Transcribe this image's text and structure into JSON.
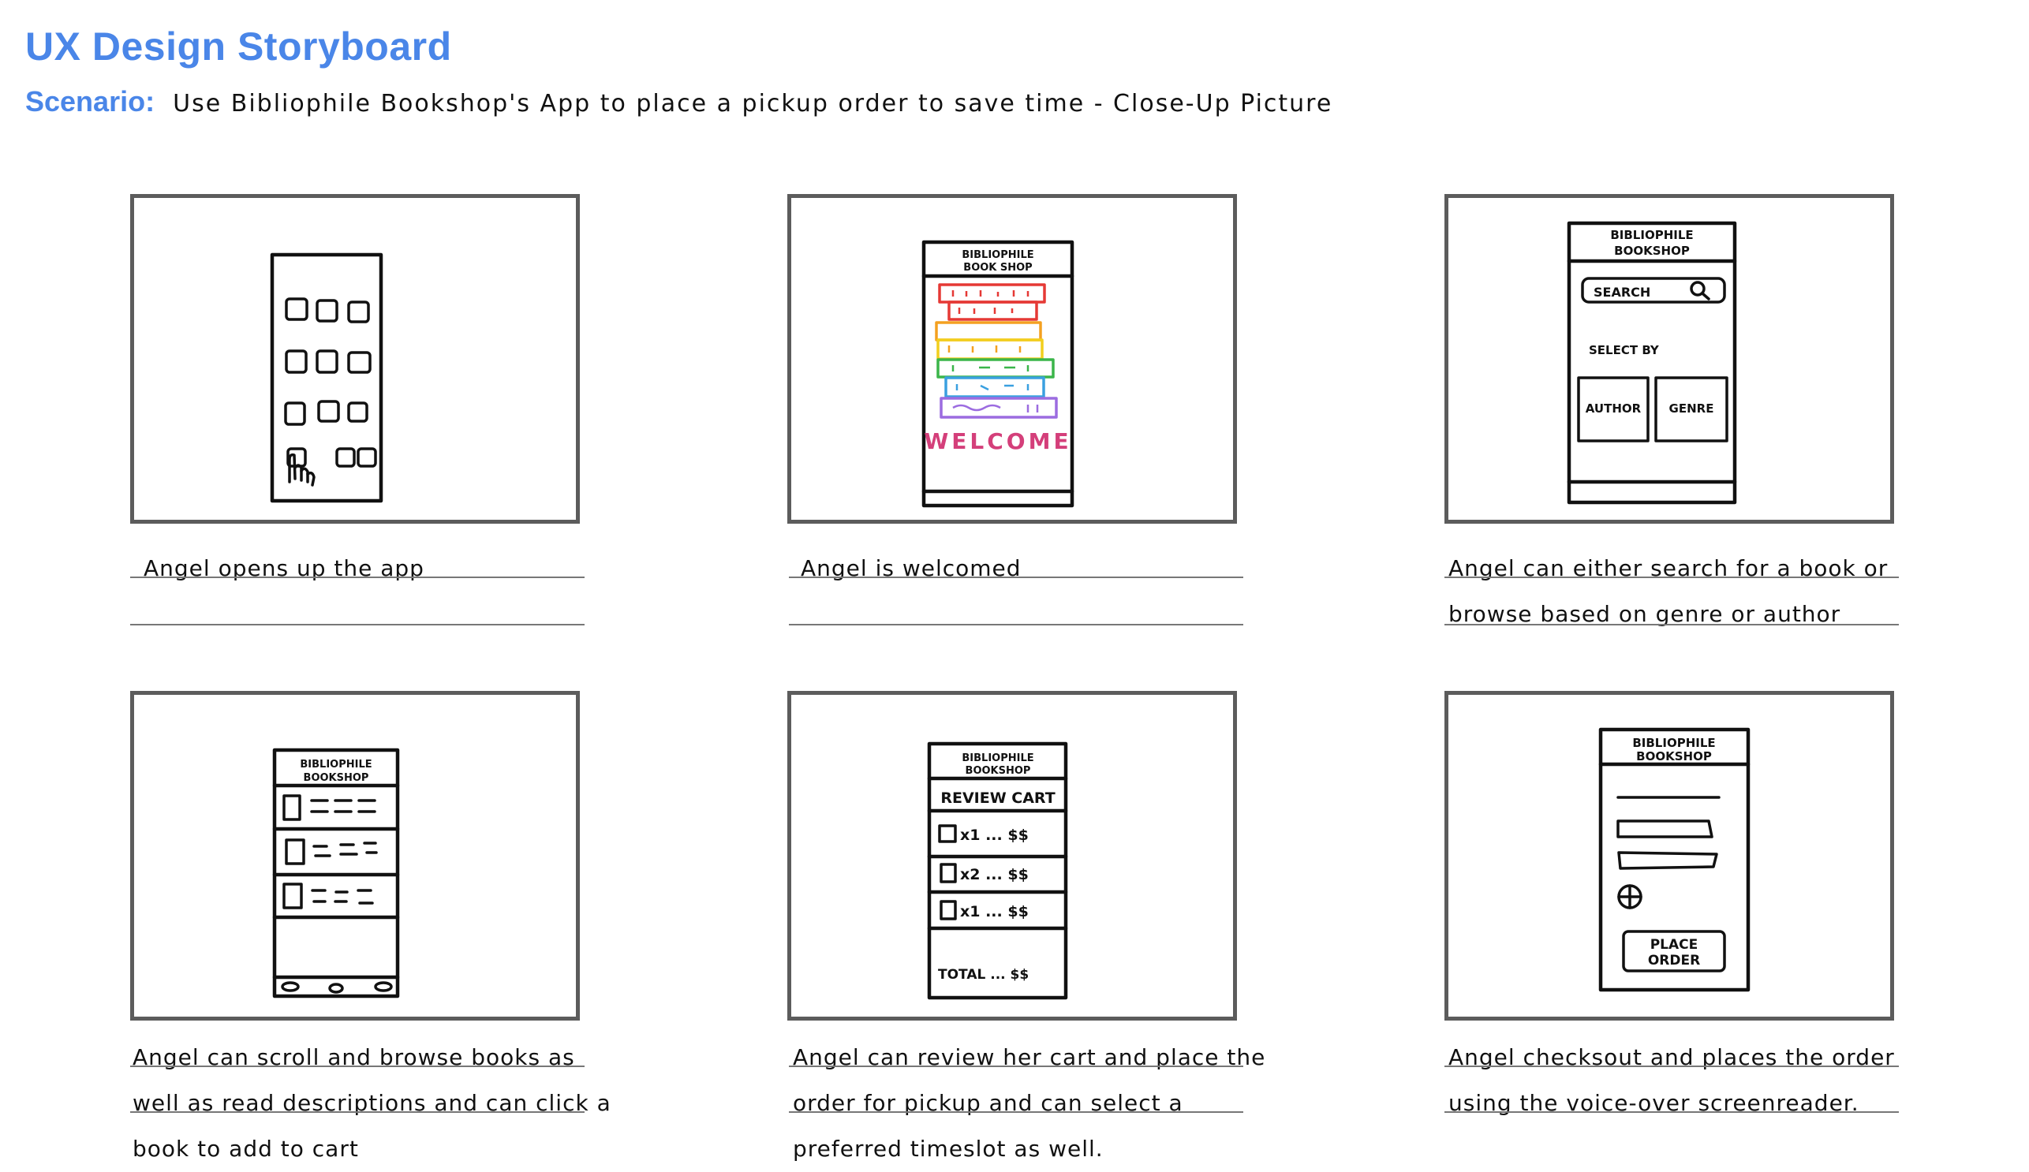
{
  "header": {
    "title": "UX Design Storyboard",
    "scenario_label": "Scenario:",
    "scenario_text": "Use  Bibliophile Bookshop's App to place a pickup order to save time  -  Close-Up Picture"
  },
  "colors": {
    "accent": "#4a86e8",
    "frame_border": "#5c5c5c",
    "welcome": "#d43f7a",
    "book_stripes": [
      "#e53935",
      "#f4a020",
      "#f2cf1d",
      "#3bb54a",
      "#3aa0e0",
      "#9c6ce0"
    ]
  },
  "panels": [
    {
      "id": 1,
      "caption": "Angel opens up the app",
      "icons": [
        "app-grid-icon",
        "tap-hand-icon"
      ]
    },
    {
      "id": 2,
      "caption": "Angel is welcomed",
      "screen": {
        "header": [
          "BIBLIOPHILE",
          "BOOK SHOP"
        ],
        "welcome_text": "WELCOME"
      },
      "icons": [
        "book-stack-icon"
      ]
    },
    {
      "id": 3,
      "caption": "Angel can either search for a book or browse based on genre or author",
      "screen": {
        "header": [
          "BIBLIOPHILE",
          "BOOKSHOP"
        ],
        "search_label": "SEARCH",
        "select_by_label": "SELECT BY",
        "author_button": "AUTHOR",
        "genre_button": "GENRE"
      },
      "icons": [
        "magnifier-icon"
      ]
    },
    {
      "id": 4,
      "caption": "Angel can scroll and browse books as well as read descriptions and can click a book to add to cart",
      "screen": {
        "header": [
          "BIBLIOPHILE",
          "BOOKSHOP"
        ]
      },
      "icons": [
        "book-thumbnail-icon",
        "nav-dots-icon"
      ]
    },
    {
      "id": 5,
      "caption": "Angel can review her cart and place the order for pickup and can select a preferred timeslot as well.",
      "screen": {
        "header": [
          "BIBLIOPHILE",
          "BOOKSHOP"
        ],
        "review_cart": "REVIEW CART",
        "items": [
          "x1 ... $$",
          "x2 ... $$",
          "x1 ... $$"
        ],
        "total": "TOTAL ... $$"
      }
    },
    {
      "id": 6,
      "caption": "Angel checksout and places the order using the voice-over screenreader.",
      "screen": {
        "header": [
          "BIBLIOPHILE",
          "BOOKSHOP"
        ],
        "place_order": [
          "PLACE",
          "ORDER"
        ]
      },
      "icons": [
        "plus-circle-icon"
      ]
    }
  ]
}
